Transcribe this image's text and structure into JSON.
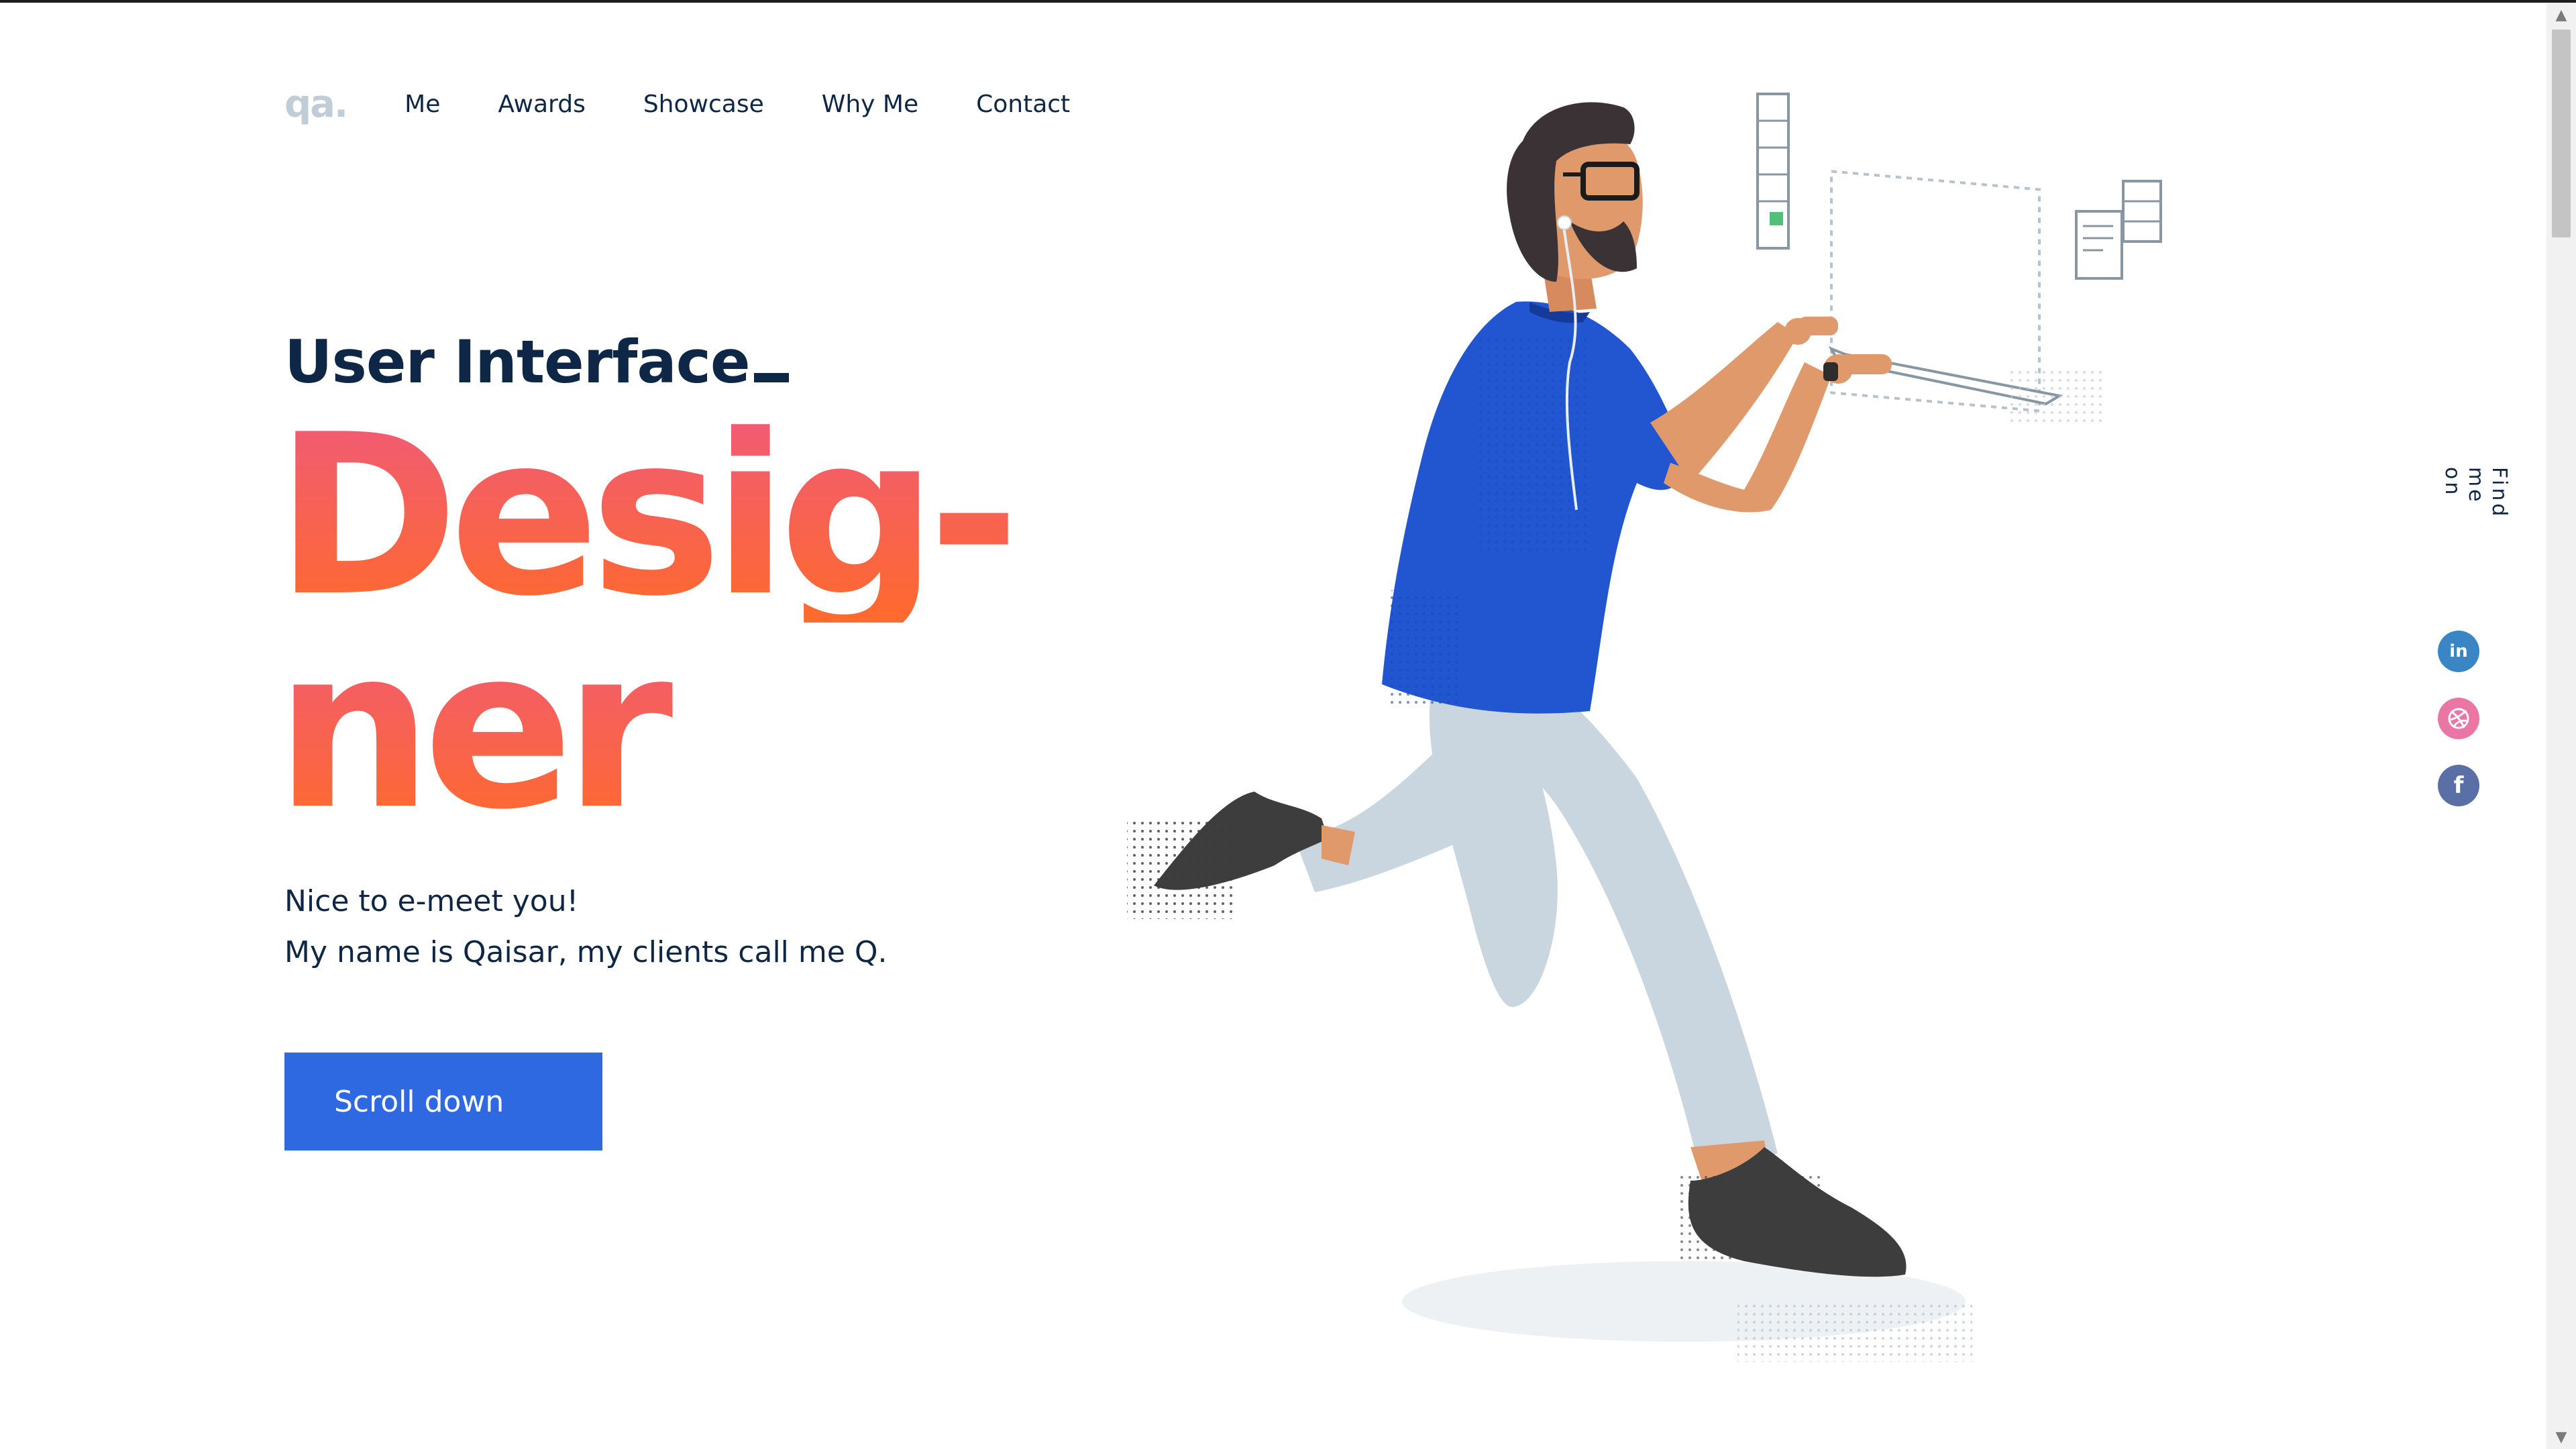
{
  "logo": "qa.",
  "nav": {
    "items": [
      "Me",
      "Awards",
      "Showcase",
      "Why Me",
      "Contact"
    ]
  },
  "hero": {
    "subtitle": "User Interface",
    "headline_line1": "Desig-",
    "headline_line2": "ner",
    "intro_line1": "Nice to e-meet you!",
    "intro_line2": "My name is Qaisar, my clients call me Q.",
    "cta": "Scroll down"
  },
  "social": {
    "label": "Find me on",
    "linkedin_glyph": "in",
    "facebook_glyph": "f",
    "colors": {
      "linkedin": "#3a86c4",
      "dribbble": "#ea76a5",
      "facebook": "#5a6fa6"
    }
  },
  "colors": {
    "accent": "#2f69e2",
    "text_dark": "#0f2747",
    "gradient_top": "#f05a78",
    "gradient_bottom": "#ff6a2c",
    "logo": "#bfcdd9"
  },
  "illustration": {
    "subject": "man-running-while-typing-icon"
  }
}
